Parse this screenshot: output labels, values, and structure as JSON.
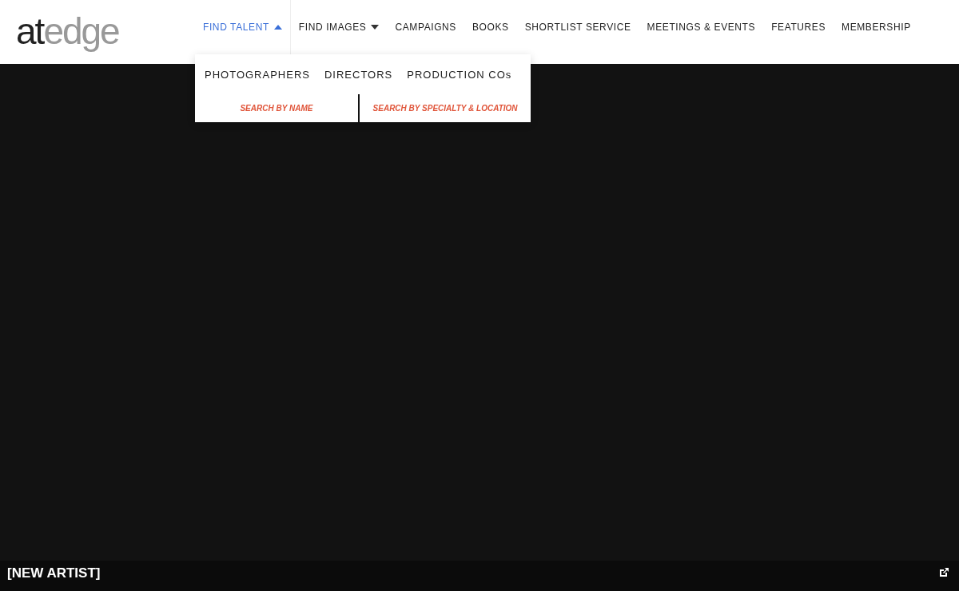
{
  "logo": {
    "part_1": "at",
    "part_2": "edge"
  },
  "nav": [
    {
      "label": "FIND TALENT",
      "selected": true,
      "expanded": true
    },
    {
      "label": "FIND IMAGES",
      "selected": false,
      "expanded": false
    },
    {
      "label": "BOOKS",
      "selected": false
    },
    {
      "label": "SHORTLIST SERVICE",
      "selected": false
    },
    {
      "label": "MEETINGS & EVENTS",
      "selected": false
    },
    {
      "label": "FEATURES",
      "selected": false
    },
    {
      "label": "MEMBERSHIP",
      "selected": false
    }
  ],
  "overlapping_nav_label": "CAMPAIGNS",
  "dropdown": {
    "categories": [
      "PHOTOGRAPHERS",
      "DIRECTORS",
      "PRODUCTION COs"
    ],
    "search_links": [
      "SEARCH BY NAME",
      "SEARCH BY SPECIALTY & LOCATION"
    ]
  },
  "artist_bar": {
    "title": "[NEW ARTIST]"
  }
}
